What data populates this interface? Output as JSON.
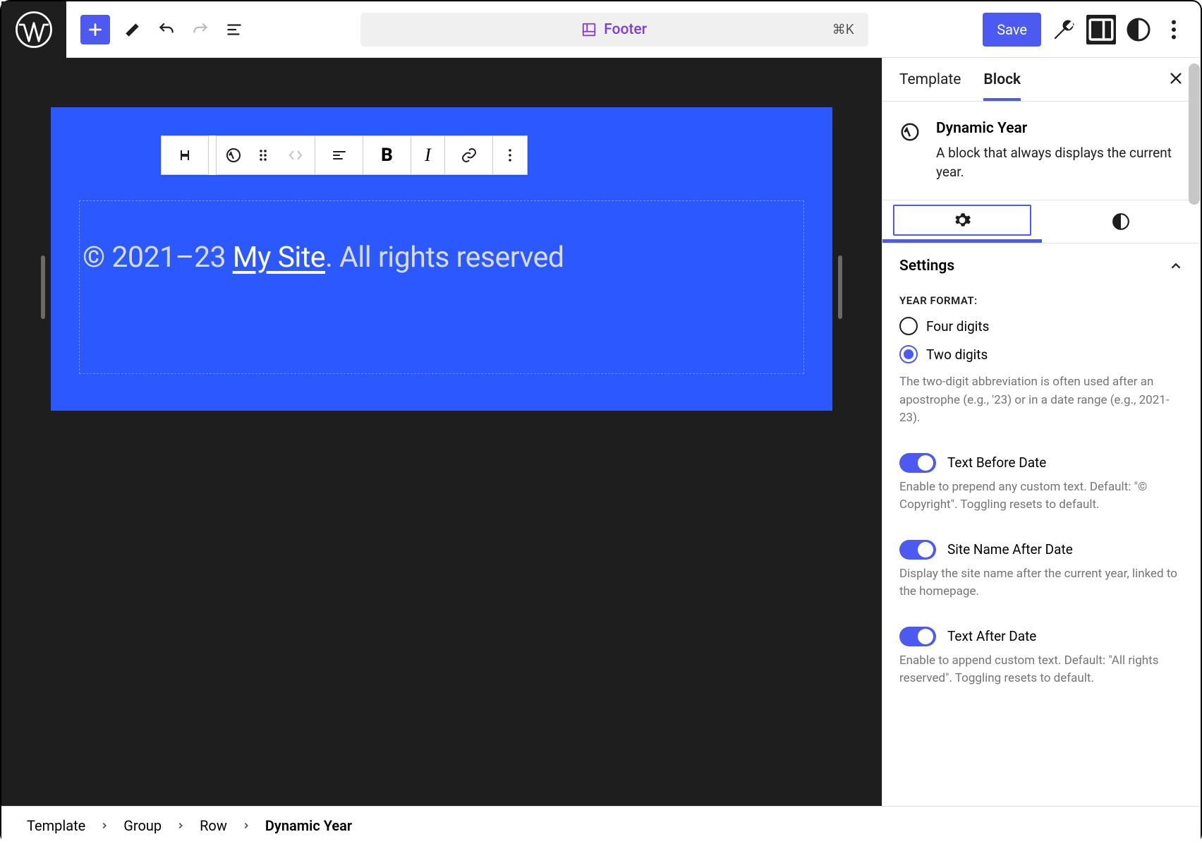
{
  "topbar": {
    "center_label": "Footer",
    "center_shortcut": "⌘K",
    "save_label": "Save"
  },
  "canvas": {
    "footer_prefix": "© 2021–23 ",
    "footer_site": "My Site",
    "footer_suffix": ". All rights reserved"
  },
  "sidebar": {
    "tabs": {
      "template": "Template",
      "block": "Block"
    },
    "block_title": "Dynamic Year",
    "block_desc": "A block that always displays the current year.",
    "section_label": "Settings",
    "year_format_label": "YEAR FORMAT:",
    "radio_four": "Four digits",
    "radio_two": "Two digits",
    "year_help": "The two-digit abbreviation is often used after an apostrophe (e.g., '23) or in a date range (e.g., 2021-23).",
    "toggle1_label": "Text Before Date",
    "toggle1_help": "Enable to prepend any custom text. Default: \"© Copyright\". Toggling resets to default.",
    "toggle2_label": "Site Name After Date",
    "toggle2_help": "Display the site name after the current year, linked to the homepage.",
    "toggle3_label": "Text After Date",
    "toggle3_help": "Enable to append custom text. Default: \"All rights reserved\". Toggling resets to default."
  },
  "breadcrumb": {
    "items": [
      "Template",
      "Group",
      "Row",
      "Dynamic Year"
    ]
  }
}
